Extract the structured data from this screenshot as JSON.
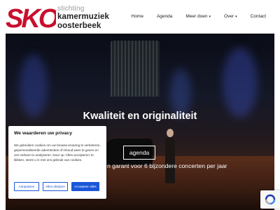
{
  "brand": {
    "mark": "SKO",
    "small": "stichting",
    "line1": "kamermuziek",
    "line2": "oosterbeek",
    "color": "#c8102e"
  },
  "nav": {
    "items": [
      {
        "label": "Home"
      },
      {
        "label": "Agenda"
      },
      {
        "label": "Meer doen",
        "caret": "▾"
      },
      {
        "label": "Over",
        "caret": "▾"
      },
      {
        "label": "Contact"
      }
    ]
  },
  "hero": {
    "title": "Kwaliteit en originaliteit",
    "subtitle": "n garant voor 6 bijzondere concerten per jaar",
    "button": "agenda"
  },
  "cookie": {
    "title": "We waarderen uw privacy",
    "body": "We gebruiken cookies om uw browse-ervaring te verbeteren, gepersonaliseerde advertenties of inhoud weer te geven en ons verkeer te analyseren. Door op 'Alles accepteren' te klikken, stemt u in met ons gebruik van cookies.",
    "buttons": {
      "customize": "Aanpassen",
      "reject": "Alles afwijzen",
      "accept": "Accepteer alles"
    },
    "accent": "#1a56d8"
  },
  "recaptcha": {
    "icon": "recaptcha-icon"
  }
}
